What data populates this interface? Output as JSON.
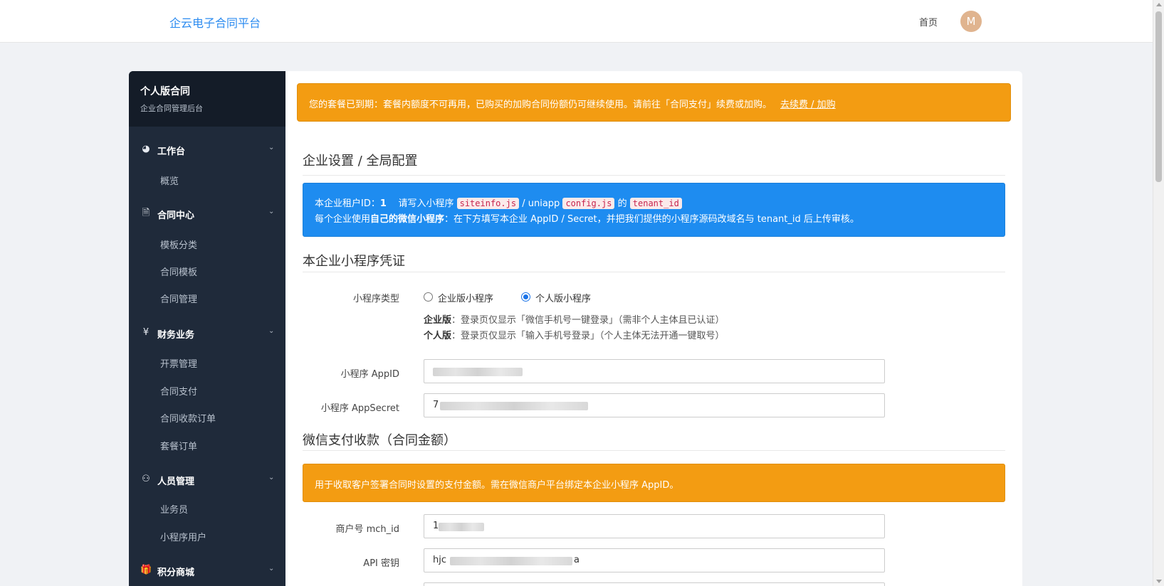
{
  "header": {
    "brand": "企云电子合同平台",
    "home_label": "首页",
    "avatar_letter": "M"
  },
  "sidebar": {
    "title": "个人版合同",
    "subtitle": "企业合同管理后台",
    "groups": [
      {
        "label": "工作台",
        "icon": "dashboard-icon",
        "items": [
          "概览"
        ]
      },
      {
        "label": "合同中心",
        "icon": "document-icon",
        "items": [
          "模板分类",
          "合同模板",
          "合同管理"
        ]
      },
      {
        "label": "财务业务",
        "icon": "yen-icon",
        "items": [
          "开票管理",
          "合同支付",
          "合同收款订单",
          "套餐订单"
        ]
      },
      {
        "label": "人员管理",
        "icon": "users-icon",
        "items": [
          "业务员",
          "小程序用户"
        ]
      },
      {
        "label": "积分商城",
        "icon": "gift-icon",
        "items": []
      }
    ]
  },
  "alerts": {
    "expired_text": "您的套餐已到期：套餐内额度不可再用，已购买的加购合同份额仍可继续使用。请前往「合同支付」续费或加购。",
    "expired_link": "去续费 / 加购",
    "info_line1_prefix": "本企业租户ID：",
    "tenant_id": "1",
    "info_line1_mid": "请写入小程序",
    "code_siteinfo": "siteinfo.js",
    "info_line1_mid2": "/ uniapp",
    "code_config": "config.js",
    "info_line1_of": "的",
    "code_tenant": "tenant_id",
    "info_line2_prefix": "每个企业使用",
    "info_line2_bold": "自己的微信小程序",
    "info_line2_suffix": "：在下方填写本企业 AppID / Secret，并把我们提供的小程序源码改域名与 tenant_id 后上传审核。",
    "pay_text": "用于收取客户签署合同时设置的支付金额。需在微信商户平台绑定本企业小程序 AppID。"
  },
  "sections": {
    "global": "企业设置 / 全局配置",
    "credentials": "本企业小程序凭证",
    "pay": "微信支付收款（合同金额）"
  },
  "form": {
    "type_label": "小程序类型",
    "type_options": [
      "企业版小程序",
      "个人版小程序"
    ],
    "hint1_bold": "企业版",
    "hint1_text": "：登录页仅显示「微信手机号一键登录」（需非个人主体且已认证）",
    "hint2_bold": "个人版",
    "hint2_text": "：登录页仅显示「输入手机号登录」（个人主体无法开通一键取号）",
    "appid_label": "小程序 AppID",
    "secret_label": "小程序 AppSecret",
    "secret_visible": "7",
    "mchid_label": "商户号 mch_id",
    "mchid_visible": "1",
    "apikey_label": "API 密钥",
    "apikey_visible_start": "hjc",
    "apikey_visible_end": "a"
  }
}
